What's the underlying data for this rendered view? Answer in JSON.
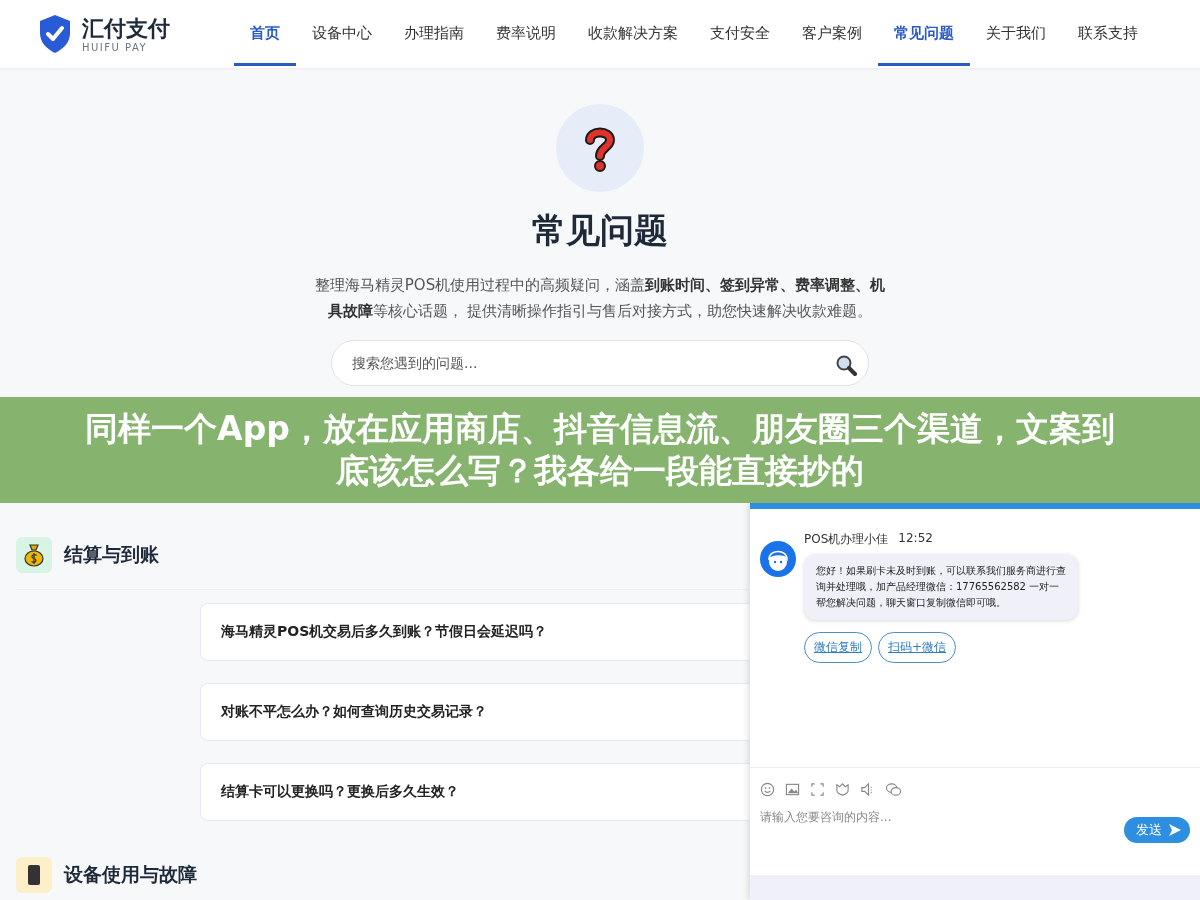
{
  "logo": {
    "name": "汇付支付",
    "subtitle": "HUIFU PAY"
  },
  "nav": [
    {
      "label": "首页",
      "selected": true
    },
    {
      "label": "设备中心",
      "selected": false
    },
    {
      "label": "办理指南",
      "selected": false
    },
    {
      "label": "费率说明",
      "selected": false
    },
    {
      "label": "收款解决方案",
      "selected": false
    },
    {
      "label": "支付安全",
      "selected": false
    },
    {
      "label": "客户案例",
      "selected": false
    },
    {
      "label": "常见问题",
      "selected": true
    },
    {
      "label": "关于我们",
      "selected": false
    },
    {
      "label": "联系支持",
      "selected": false
    }
  ],
  "hero": {
    "title": "常见问题",
    "description": "整理海马精灵POS机使用过程中的高频疑问，涵盖**到账时间、签到异常、费率调整、机具故障**等核心话题， 提供清晰操作指引与售后对接方式，助您快速解决收款难题。",
    "search_placeholder": "搜索您遇到的问题..."
  },
  "sections": [
    {
      "title": "结算与到账",
      "kind": "money",
      "questions": [
        "海马精灵POS机交易后多久到账？节假日会延迟吗？",
        "对账不平怎么办？如何查询历史交易记录？",
        "结算卡可以更换吗？更换后多久生效？"
      ]
    },
    {
      "title": "设备使用与故障",
      "kind": "device"
    }
  ],
  "chat": {
    "agent_name": "POS机办理小佳",
    "time": "12:52",
    "message": "您好！如果刷卡未及时到账，可以联系我们服务商进行查询并处理哦，加产品经理微信：17765562582 一对一帮您解决问题，聊天窗口复制微信即可哦。",
    "buttons": [
      "微信复制",
      "扫码+微信"
    ],
    "input_placeholder": "请输入您要咨询的内容...",
    "send_label": "发送"
  },
  "overlay_banner": {
    "text": "同样一个App，放在应用商店、抖音信息流、朋友圈三个渠道，文案到底该怎么写？我各给一段能直接抄的"
  }
}
